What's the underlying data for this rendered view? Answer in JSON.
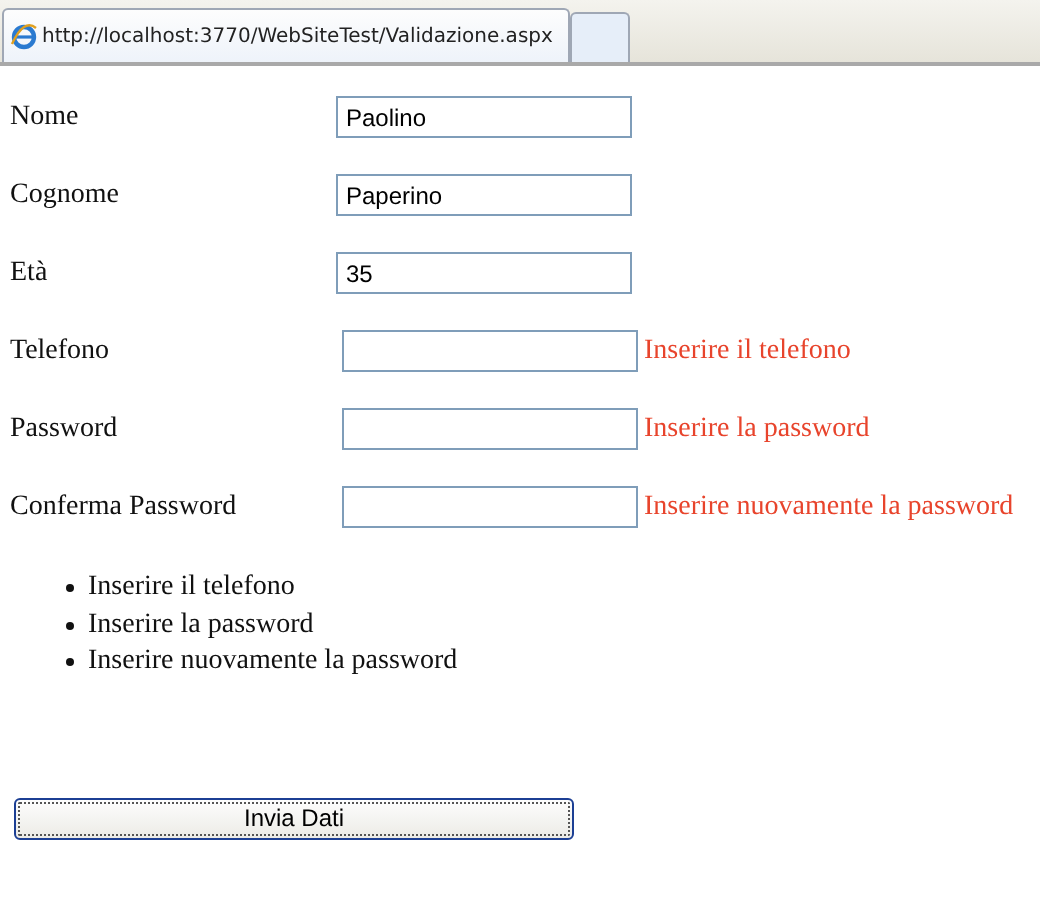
{
  "tab": {
    "title": "http://localhost:3770/WebSiteTest/Validazione.aspx"
  },
  "fields": [
    {
      "label": "Nome",
      "value": "Paolino"
    },
    {
      "label": "Cognome",
      "value": "Paperino"
    },
    {
      "label": "Età",
      "value": "35"
    },
    {
      "label": "Telefono",
      "error": "Inserire il telefono"
    },
    {
      "label": "Password",
      "error": "Inserire la password"
    },
    {
      "label": "Conferma Password",
      "error": "Inserire nuovamente la password"
    }
  ],
  "summary": [
    "Inserire il telefono",
    "Inserire la password",
    "Inserire nuovamente la password"
  ],
  "submit": {
    "label": "Invia Dati"
  }
}
